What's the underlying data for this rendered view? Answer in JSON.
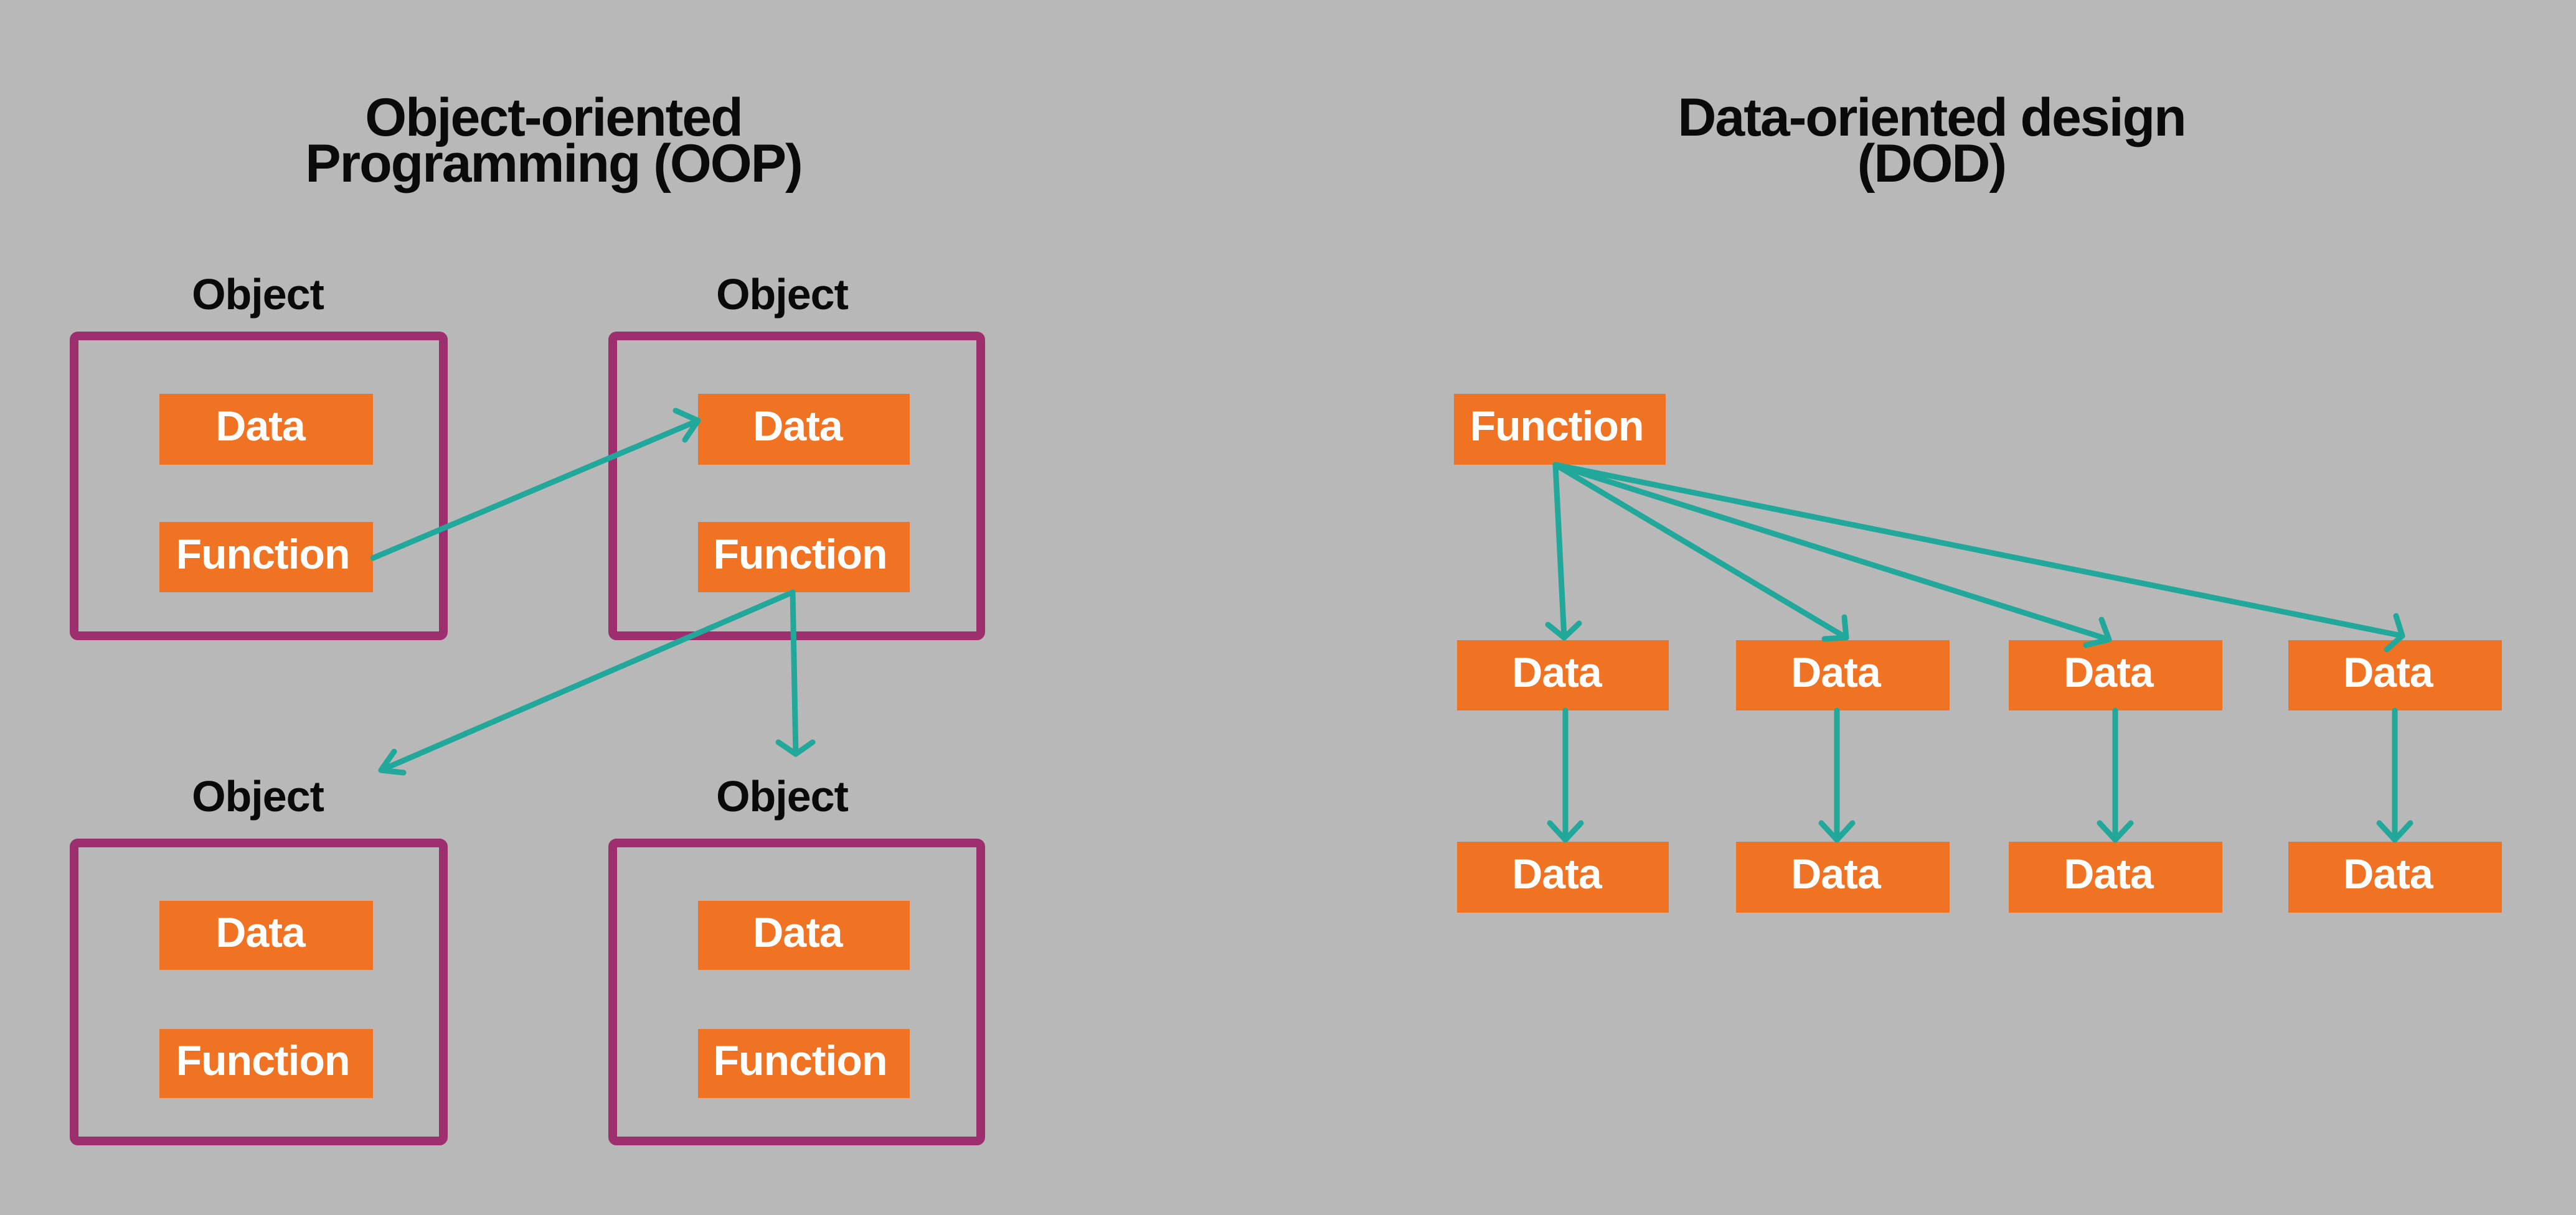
{
  "oop": {
    "title_line1": "Object-oriented",
    "title_line2": "Programming (OOP)",
    "objects": [
      {
        "label": "Object",
        "data": "Data",
        "function": "Function"
      },
      {
        "label": "Object",
        "data": "Data",
        "function": "Function"
      },
      {
        "label": "Object",
        "data": "Data",
        "function": "Function"
      },
      {
        "label": "Object",
        "data": "Data",
        "function": "Function"
      }
    ],
    "connections": [
      {
        "from": "object-1.function",
        "to": "object-2.data"
      },
      {
        "from": "object-2.function",
        "to": "object-3"
      },
      {
        "from": "object-2.function",
        "to": "object-4"
      }
    ]
  },
  "dod": {
    "title_line1": "Data-oriented design",
    "title_line2": "(DOD)",
    "function_label": "Function",
    "row1": [
      "Data",
      "Data",
      "Data",
      "Data"
    ],
    "row2": [
      "Data",
      "Data",
      "Data",
      "Data"
    ],
    "connections": [
      {
        "from": "function",
        "to": "row1.*"
      },
      {
        "from": "row1.i",
        "to": "row2.i"
      }
    ]
  },
  "colors": {
    "background": "#b8b8b8",
    "node": "#f07323",
    "object_frame": "#9e2f6e",
    "arrow": "#22a89a",
    "text_dark": "#0a0a0a",
    "text_light": "#ffffff"
  }
}
